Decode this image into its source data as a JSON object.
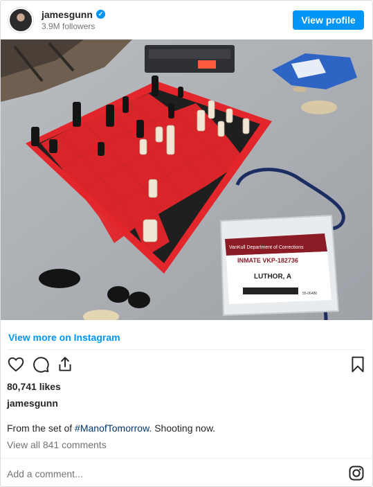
{
  "header": {
    "username": "jamesgunn",
    "verified_mark": "✓",
    "followers": "3.9M followers",
    "view_profile_label": "View profile"
  },
  "photo": {
    "tag_department": "VanKull Department of Corrections",
    "tag_inmate": "INMATE VKP-182736",
    "tag_name": "LUTHOR, A",
    "tag_code": "55-06486"
  },
  "view_more_label": "View more on Instagram",
  "actions": {
    "like_icon": "heart-icon",
    "comment_icon": "comment-icon",
    "share_icon": "share-icon",
    "save_icon": "bookmark-icon"
  },
  "likes": "80,741 likes",
  "author": "jamesgunn",
  "caption": {
    "prefix": "From the set of ",
    "hashtag": "#ManofTomorrow",
    "suffix": ". Shooting now."
  },
  "view_comments_label": "View all 841 comments",
  "comment_placeholder": "Add a comment...",
  "colors": {
    "accent": "#0095f6",
    "hashtag": "#00376b",
    "board_red": "#e3262b"
  }
}
